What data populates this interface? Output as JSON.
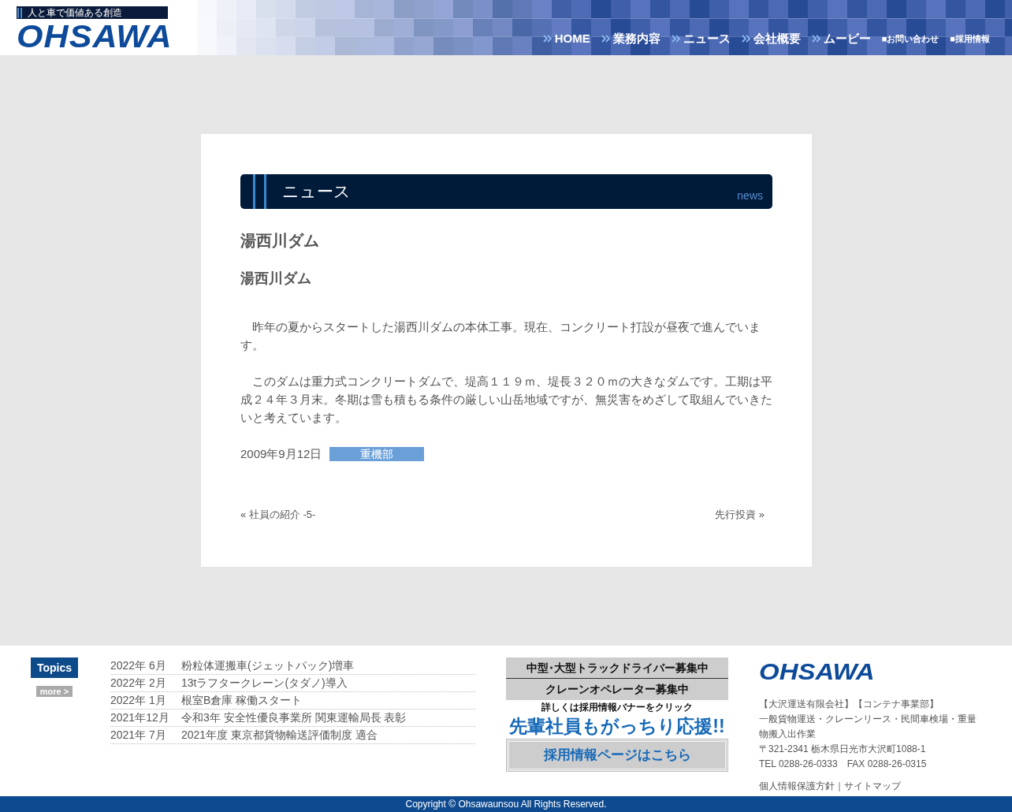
{
  "header": {
    "tagline": "人と車で価値ある創造",
    "logo": "OHSAWA",
    "nav": [
      {
        "label": "HOME",
        "kind": "main"
      },
      {
        "label": "業務内容",
        "kind": "main"
      },
      {
        "label": "ニュース",
        "kind": "main"
      },
      {
        "label": "会社概要",
        "kind": "main"
      },
      {
        "label": "ムービー",
        "kind": "main"
      },
      {
        "label": "■お問い合わせ",
        "kind": "sub"
      },
      {
        "label": "■採用情報",
        "kind": "sub"
      }
    ]
  },
  "article": {
    "section_title": "ニュース",
    "section_tag": "news",
    "title": "湯西川ダム",
    "subtitle": "湯西川ダム",
    "paragraphs": [
      "　昨年の夏からスタートした湯西川ダムの本体工事。現在、コンクリート打設が昼夜で進んでいます。",
      "　このダムは重力式コンクリートダムで、堤高１１９ｍ、堤長３２０ｍの大きなダムです。工期は平成２４年３月末。冬期は雪も積もる条件の厳しい山岳地域ですが、無災害をめざして取組んでいきたいと考えています。"
    ],
    "date": "2009年9月12日",
    "category": "重機部",
    "prev_link": "« 社員の紹介 -5-",
    "next_link": "先行投資 »"
  },
  "footer": {
    "topics_label": "Topics",
    "more_label": "more >",
    "topics": [
      {
        "date": "2022年 6月",
        "title": "粉粒体運搬車(ジェットパック)増車"
      },
      {
        "date": "2022年 2月",
        "title": "13tラフタークレーン(タダノ)導入"
      },
      {
        "date": "2022年 1月",
        "title": "根室B倉庫 稼働スタート"
      },
      {
        "date": "2021年12月",
        "title": "令和3年 安全性優良事業所 関東運輸局長 表彰"
      },
      {
        "date": "2021年 7月",
        "title": "2021年度 東京都貨物輸送評価制度 適合"
      }
    ],
    "banner": {
      "lines": [
        "中型･大型トラックドライバー募集中",
        "クレーンオペレーター募集中"
      ],
      "note": "詳しくは採用情報バナーをクリック",
      "slogan": "先輩社員もがっちり応援!!",
      "button": "採用情報ページはこちら"
    },
    "company": {
      "logo": "OHSAWA",
      "lines": [
        "【大沢運送有限会社】【コンテナ事業部】",
        "一般貨物運送・クレーンリース・民間車検場・重量物搬入出作業",
        "〒321-2341 栃木県日光市大沢町1088-1",
        "TEL 0288-26-0333　FAX 0288-26-0315"
      ],
      "links": [
        "個人情報保護方針",
        "サイトマップ"
      ],
      "link_separator": "｜"
    },
    "copyright": "Copyright © Ohsawaunsou All Rights Reserved."
  }
}
